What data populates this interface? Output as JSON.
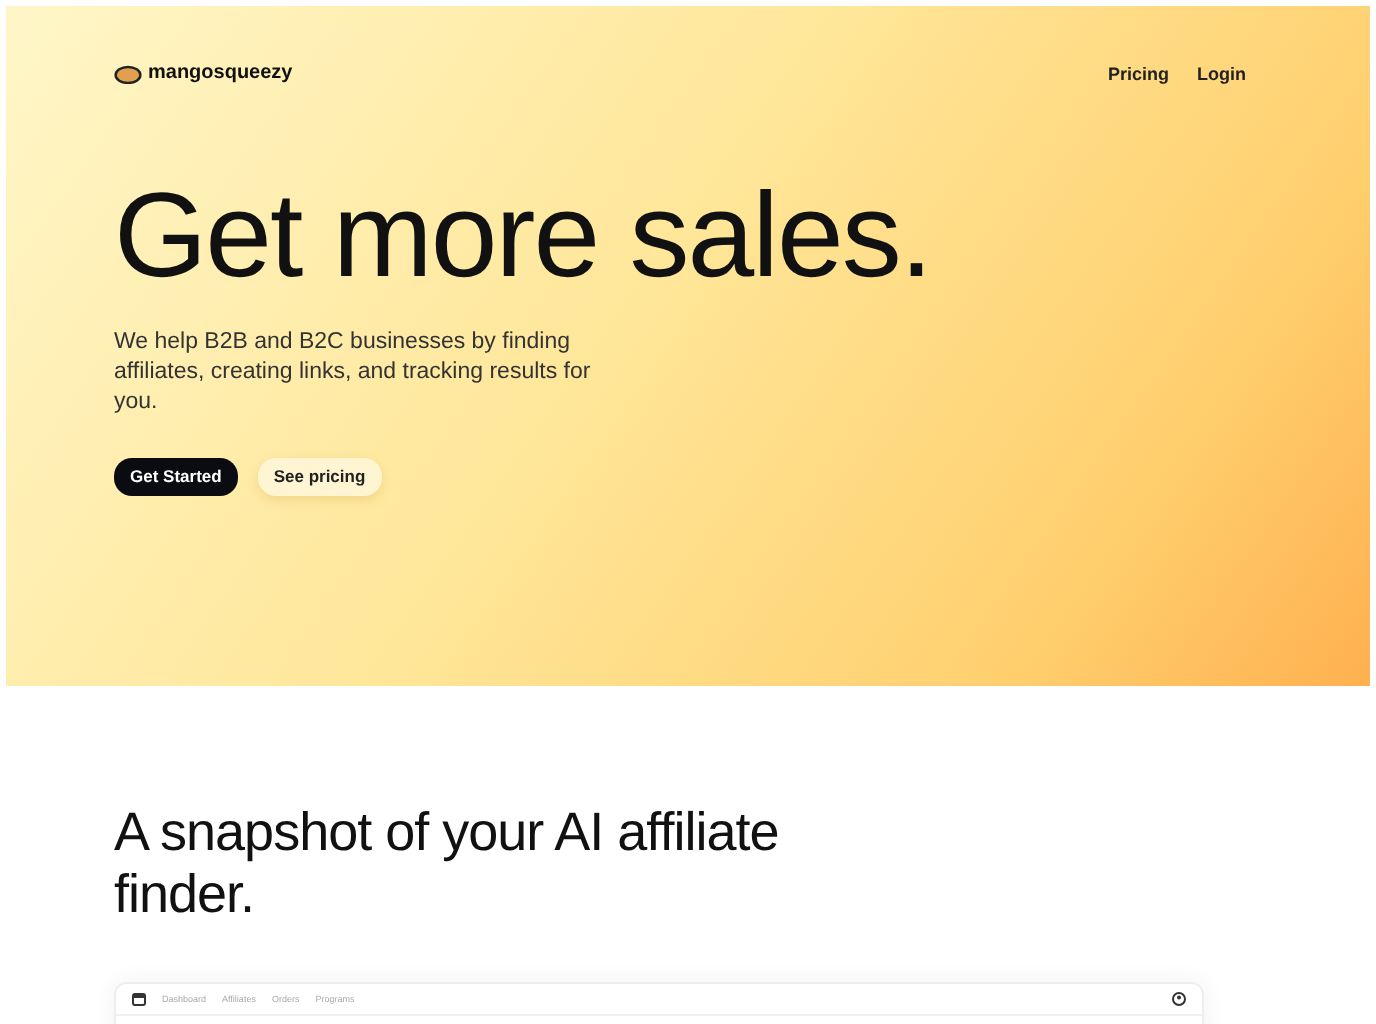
{
  "header": {
    "logo": "mangosqueezy",
    "nav": [
      "Pricing",
      "Login"
    ]
  },
  "hero": {
    "title": "Get more sales.",
    "subtitle": "We help B2B and B2C businesses by finding affiliates, creating links, and tracking results for you.",
    "buttons": [
      {
        "label": "Get Started",
        "kind": "primary"
      },
      {
        "label": "See pricing",
        "kind": "secondary"
      }
    ]
  },
  "snapshot": {
    "title": "A snapshot of your AI affiliate finder.",
    "app_tabs": [
      "Dashboard",
      "Affiliates",
      "Orders",
      "Programs"
    ]
  }
}
